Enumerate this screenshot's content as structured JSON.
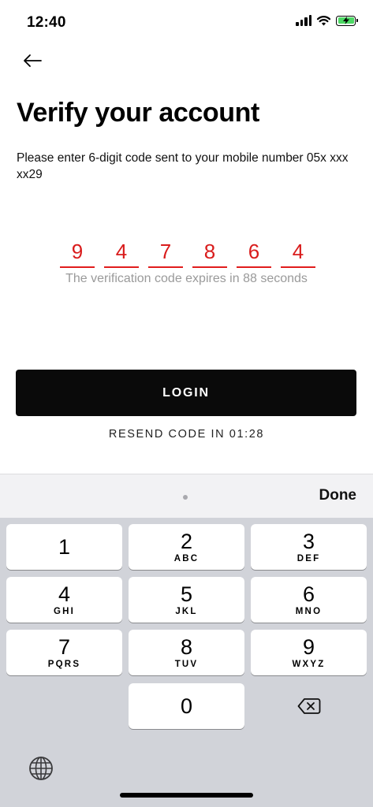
{
  "status_bar": {
    "time": "12:40"
  },
  "header": {
    "title": "Verify your account",
    "subtitle": "Please enter 6-digit code sent to your mobile number 05x xxx xx29"
  },
  "otp": {
    "digits": [
      "9",
      "4",
      "7",
      "8",
      "6",
      "4"
    ],
    "timer_text": "The verification code expires in 88 seconds"
  },
  "actions": {
    "login_label": "LOGIN",
    "resend_label": "RESEND CODE IN 01:28"
  },
  "keyboard": {
    "done_label": "Done",
    "keys": [
      {
        "digit": "1",
        "letters": ""
      },
      {
        "digit": "2",
        "letters": "ABC"
      },
      {
        "digit": "3",
        "letters": "DEF"
      },
      {
        "digit": "4",
        "letters": "GHI"
      },
      {
        "digit": "5",
        "letters": "JKL"
      },
      {
        "digit": "6",
        "letters": "MNO"
      },
      {
        "digit": "7",
        "letters": "PQRS"
      },
      {
        "digit": "8",
        "letters": "TUV"
      },
      {
        "digit": "9",
        "letters": "WXYZ"
      },
      {
        "digit": "0",
        "letters": ""
      }
    ]
  },
  "colors": {
    "accent_red": "#d91c1c",
    "button_black": "#0a0a0a",
    "battery_green": "#4cd964",
    "keyboard_bg": "#d1d3d9"
  },
  "icons": {
    "back": "arrow-left-icon",
    "signal": "cellular-signal-icon",
    "wifi": "wifi-icon",
    "battery": "battery-charging-icon",
    "delete": "backspace-icon",
    "globe": "globe-icon"
  }
}
